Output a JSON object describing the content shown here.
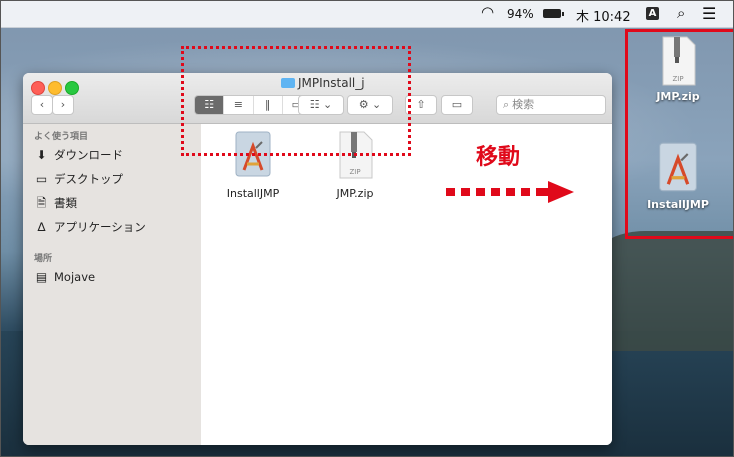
{
  "menubar": {
    "battery_pct": "94%",
    "clock": "木 10:42",
    "input_mode": "A"
  },
  "window": {
    "title": "JMPInstall_j",
    "search_placeholder": "検索"
  },
  "sidebar": {
    "favorites_header": "よく使う項目",
    "items": [
      {
        "label": "ダウンロード",
        "icon": "download-icon"
      },
      {
        "label": "デスクトップ",
        "icon": "desktop-icon"
      },
      {
        "label": "書類",
        "icon": "documents-icon"
      },
      {
        "label": "アプリケーション",
        "icon": "applications-icon"
      }
    ],
    "locations_header": "場所",
    "locations": [
      {
        "label": "Mojave",
        "icon": "disk-icon"
      }
    ]
  },
  "files": [
    {
      "name": "InstallJMP",
      "icon": "installer-app-icon"
    },
    {
      "name": "JMP.zip",
      "icon": "zip-file-icon",
      "badge": "ZIP"
    }
  ],
  "annotation": {
    "move_label": "移動",
    "color": "#e0091a"
  },
  "desktop_files": [
    {
      "name": "JMP.zip",
      "icon": "zip-file-icon",
      "badge": "ZIP"
    },
    {
      "name": "InstallJMP",
      "icon": "installer-app-icon"
    }
  ]
}
